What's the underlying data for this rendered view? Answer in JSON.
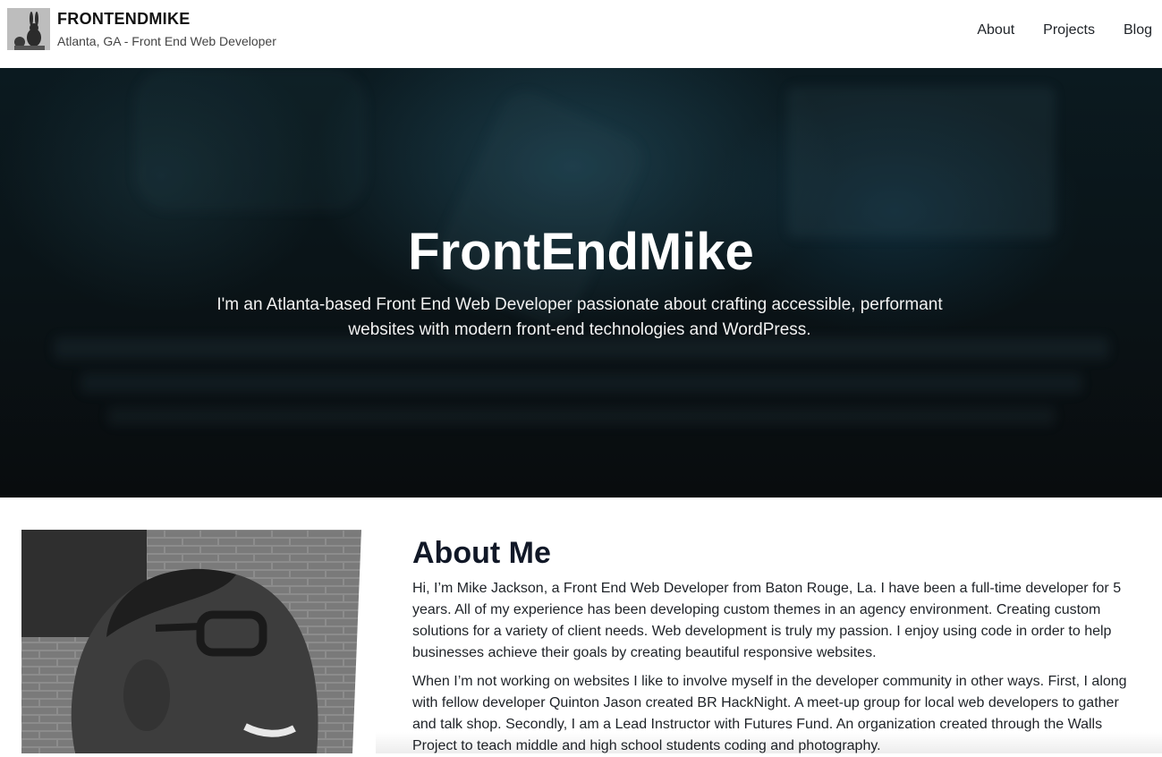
{
  "header": {
    "logo_icon": "bunny-figurine-logo-icon",
    "title": "FRONTENDMIKE",
    "subtitle": "Atlanta, GA - Front End Web Developer",
    "nav": [
      "About",
      "Projects",
      "Blog"
    ]
  },
  "hero": {
    "background": "blurred-laptop-keyboard-photo",
    "title": "FrontEndMike",
    "text": "I'm an Atlanta-based Front End Web Developer passionate about crafting accessible, performant websites with modern front-end technologies and WordPress."
  },
  "about": {
    "photo": "portrait-photo",
    "title": "About Me",
    "paragraphs": [
      "Hi, I’m Mike Jackson, a Front End Web Developer from Baton Rouge, La. I have been a full-time developer for 5 years. All of my experience has been developing custom themes in an agency environment. Creating custom solutions for a variety of client needs. Web development is truly my passion. I enjoy using code in order to help businesses achieve their goals by creating beautiful responsive websites.",
      "When I’m not working on websites I like to involve myself in the developer community in other ways. First, I along with fellow developer Quinton Jason created BR HackNight. A meet-up group for local web developers to gather and talk shop. Secondly, I am a Lead Instructor with Futures Fund. An organization created through the Walls Project to teach middle and high school students coding and photography."
    ]
  },
  "colors": {
    "accent_teal": "#1c4a5a",
    "hero_dark": "#090c0e",
    "text": "#1f2328"
  }
}
